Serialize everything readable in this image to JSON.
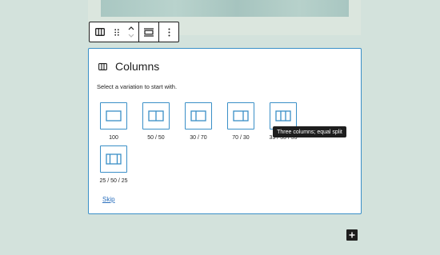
{
  "block": {
    "title": "Columns",
    "instruction": "Select a variation to start with.",
    "skip_label": "Skip",
    "icon": "columns-block-icon"
  },
  "toolbar": {
    "items": [
      "columns-block-icon",
      "drag-handle-icon",
      "move-up-down-icon",
      "align-icon",
      "more-options-icon"
    ]
  },
  "variations": [
    {
      "label": "100",
      "icon": "variation-100-icon"
    },
    {
      "label": "50 / 50",
      "icon": "variation-50-50-icon"
    },
    {
      "label": "30 / 70",
      "icon": "variation-30-70-icon"
    },
    {
      "label": "70 / 30",
      "icon": "variation-70-30-icon"
    },
    {
      "label": "33 / 33 / 33",
      "icon": "variation-33-33-33-icon"
    },
    {
      "label": "25 / 50 / 25",
      "icon": "variation-25-50-25-icon"
    }
  ],
  "tooltip": {
    "text": "Three columns; equal split"
  },
  "colors": {
    "accent": "#3a8fc7",
    "dark": "#1e1e1e",
    "background": "#d3e2dc"
  }
}
